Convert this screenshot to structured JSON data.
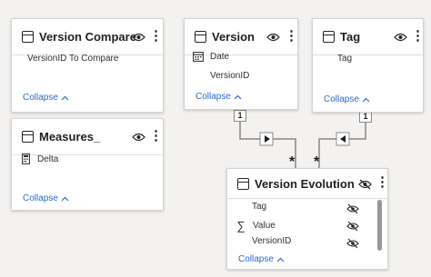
{
  "tables": {
    "version_compare": {
      "title": "Version Compare",
      "fields": [
        "VersionID To Compare"
      ],
      "collapse": "Collapse"
    },
    "version": {
      "title": "Version",
      "fields": [
        "Date",
        "VersionID"
      ],
      "collapse": "Collapse"
    },
    "tag": {
      "title": "Tag",
      "fields": [
        "Tag"
      ],
      "collapse": "Collapse"
    },
    "measures": {
      "title": "Measures_",
      "fields": [
        "Delta"
      ],
      "collapse": "Collapse"
    },
    "version_evolution": {
      "title": "Version Evolution",
      "fields": [
        "Tag",
        "Value",
        "VersionID"
      ],
      "collapse": "Collapse"
    }
  },
  "relationships": {
    "one_label": "1",
    "many_label": "*"
  },
  "colors": {
    "background": "#f3f2f1",
    "link": "#2b6bd1",
    "line": "#8a8886"
  }
}
